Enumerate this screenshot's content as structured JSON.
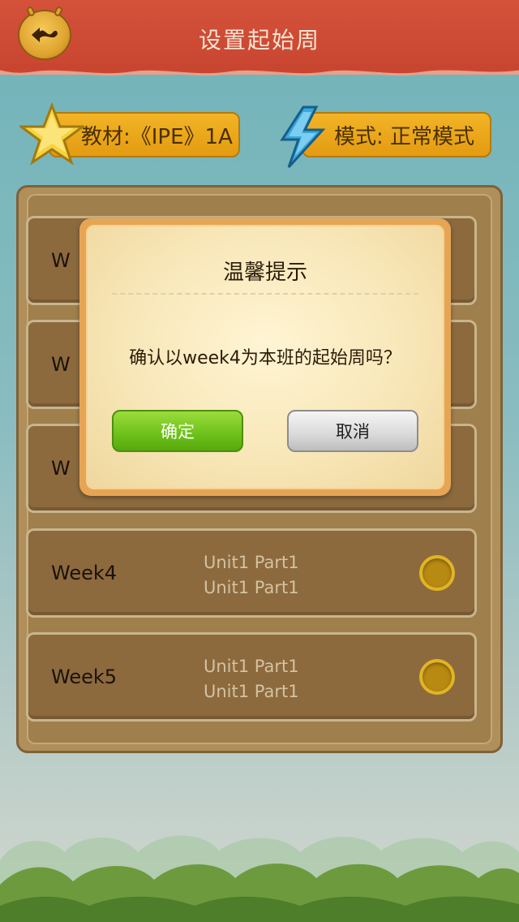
{
  "header": {
    "title": "设置起始周"
  },
  "info": {
    "book_label": "教材:《IPE》1A",
    "mode_label": "模式: 正常模式"
  },
  "weeks": [
    {
      "label": "W",
      "units": [
        "",
        ""
      ]
    },
    {
      "label": "W",
      "units": [
        "",
        ""
      ]
    },
    {
      "label": "W",
      "units": [
        "",
        ""
      ]
    },
    {
      "label": "Week4",
      "units": [
        "Unit1 Part1",
        "Unit1 Part1"
      ]
    },
    {
      "label": "Week5",
      "units": [
        "Unit1 Part1",
        "Unit1 Part1"
      ]
    }
  ],
  "dialog": {
    "title": "温馨提示",
    "message": "确认以week4为本班的起始周吗？",
    "confirm_label": "确定",
    "cancel_label": "取消"
  },
  "colors": {
    "header_red": "#d4513a",
    "badge_orange": "#f3b426",
    "board_brown": "#8c6a3e",
    "confirm_green": "#6cc019",
    "radio_gold": "#e0b423"
  }
}
